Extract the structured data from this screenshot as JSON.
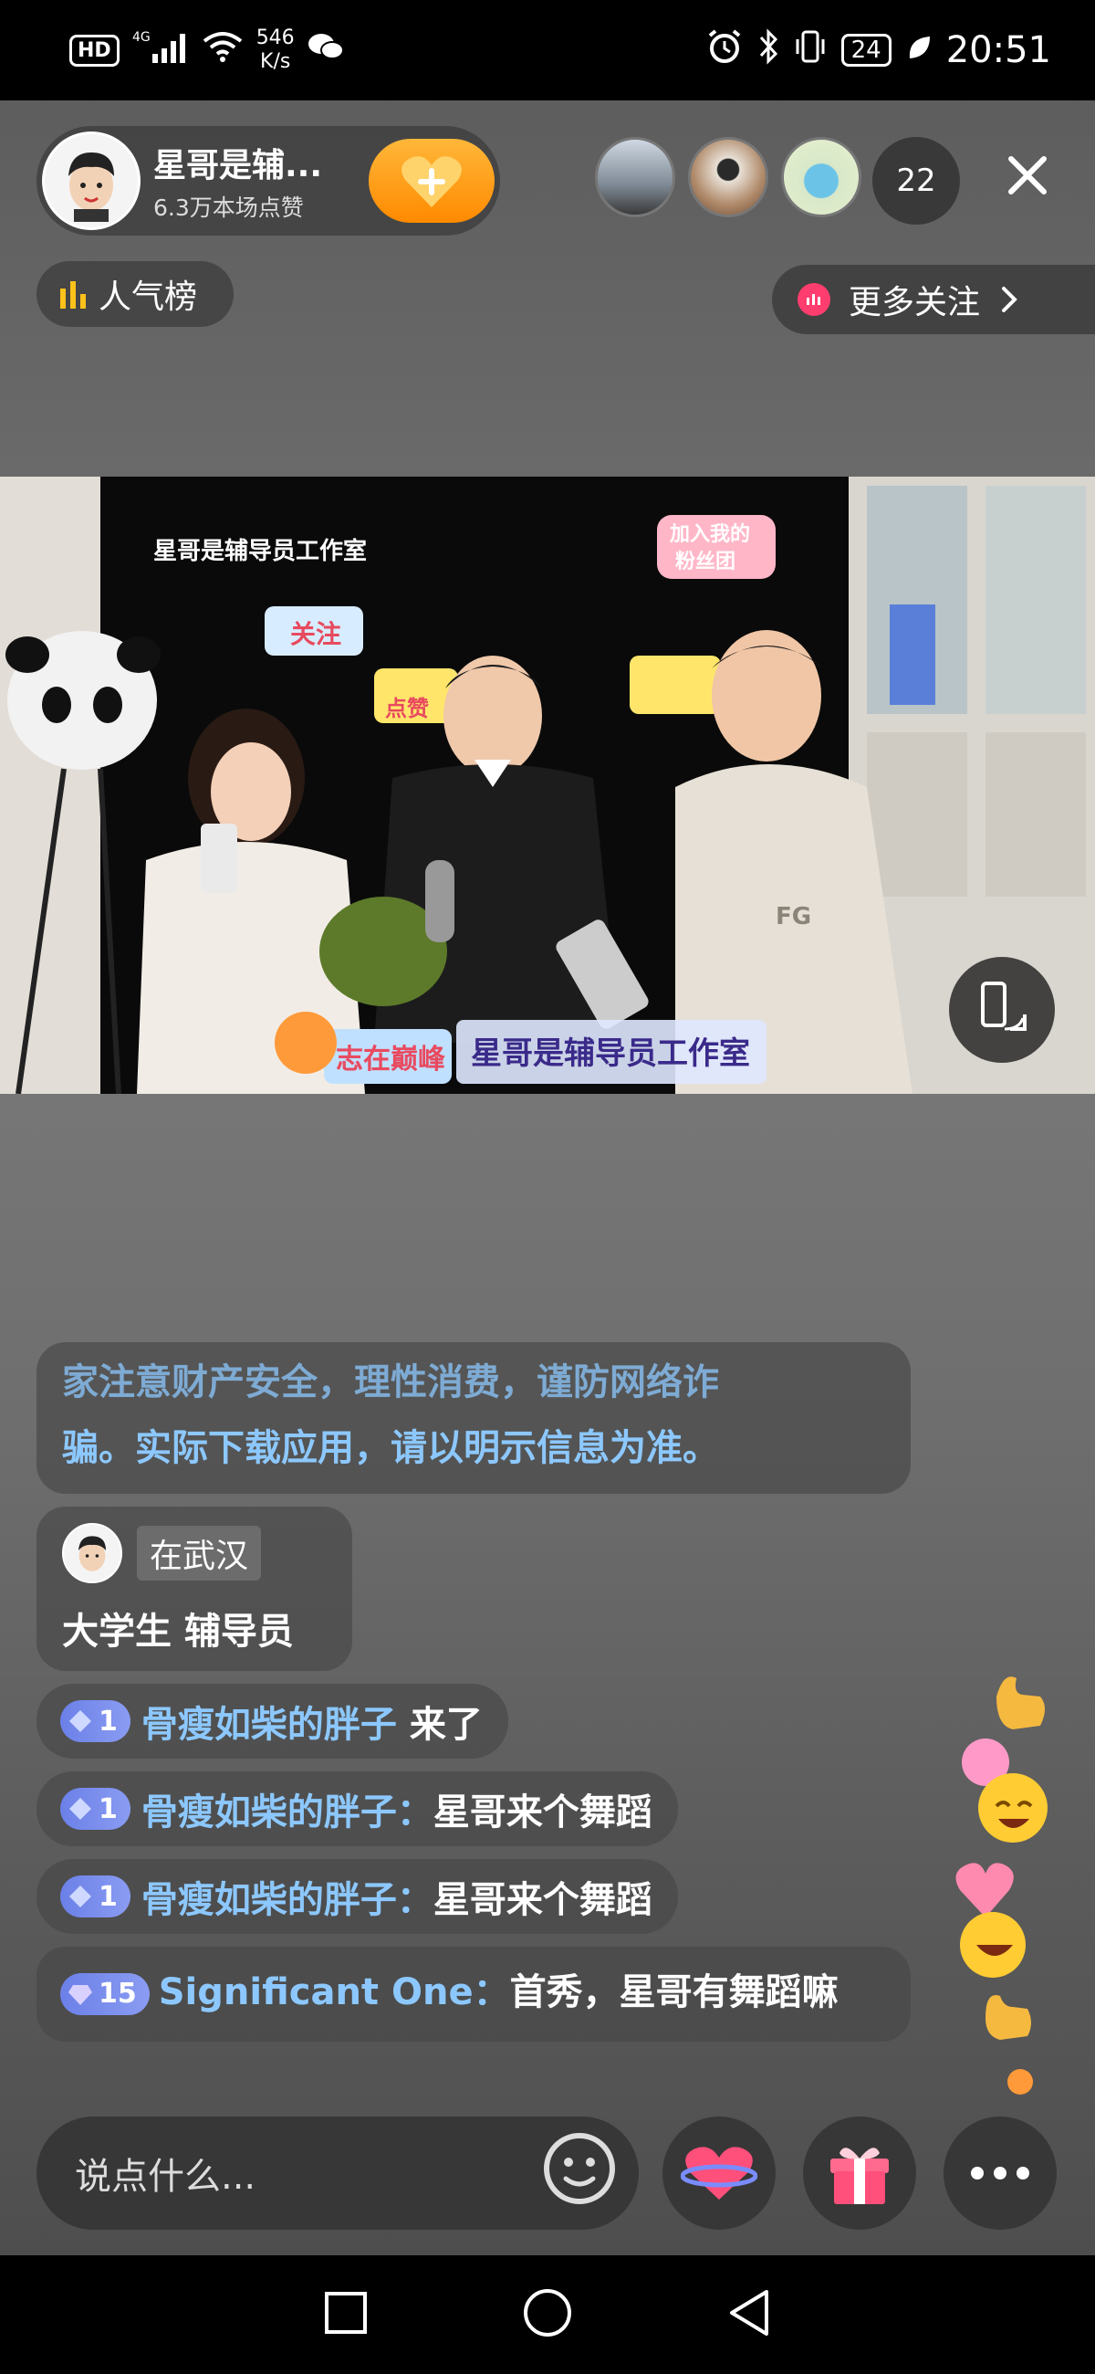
{
  "status_bar": {
    "hd": "HD",
    "signal": "4G",
    "net_speed_value": "546",
    "net_speed_unit": "K/s",
    "battery": "24",
    "time": "20:51"
  },
  "header": {
    "streamer_name": "星哥是辅...",
    "likes": "6.3万本场点赞",
    "viewer_count": "22",
    "rank_label": "人气榜",
    "more_follow_label": "更多关注"
  },
  "video": {
    "backdrop_title": "星哥是辅导员工作室",
    "sticker_follow": "关注",
    "sticker_like": "点赞",
    "sticker_fan_top": "加入我的",
    "sticker_fan_bottom": "粉丝团",
    "desk_sign": "星哥是辅导员工作室",
    "desk_slogan": "志在巅峰"
  },
  "chat": {
    "notice_line1": "家注意财产安全，理性消费，谨防网络诈",
    "notice_line2": "骗。实际下载应用，请以明示信息为准。",
    "profile": {
      "location": "在武汉",
      "bio": "大学生 辅导员"
    },
    "messages": [
      {
        "level": "1",
        "user": "骨瘦如柴的胖子",
        "sep": " ",
        "text": "来了"
      },
      {
        "level": "1",
        "user": "骨瘦如柴的胖子",
        "sep": "：",
        "text": "星哥来个舞蹈"
      },
      {
        "level": "1",
        "user": "骨瘦如柴的胖子",
        "sep": "：",
        "text": "星哥来个舞蹈"
      }
    ],
    "long_message": {
      "level": "15",
      "user": "Significant One",
      "sep": "：",
      "text": "首秀，星哥有舞蹈嘛"
    }
  },
  "input": {
    "placeholder": "说点什么..."
  },
  "colors": {
    "accent_blue": "#8cc8ff",
    "like_orange": "#ff9a1a",
    "gift_pink": "#ff4f7b"
  },
  "icons": [
    "hd-badge-icon",
    "signal-icon",
    "wifi-icon",
    "wechat-icon",
    "alarm-icon",
    "bluetooth-icon",
    "vibrate-icon",
    "battery-icon",
    "leaf-icon",
    "heart-plus-icon",
    "close-icon",
    "bar-chart-icon",
    "chevron-right-icon",
    "rotate-screen-icon",
    "emoji-icon",
    "heart-planet-icon",
    "gift-icon",
    "more-icon",
    "square-nav-icon",
    "circle-nav-icon",
    "back-nav-icon"
  ]
}
